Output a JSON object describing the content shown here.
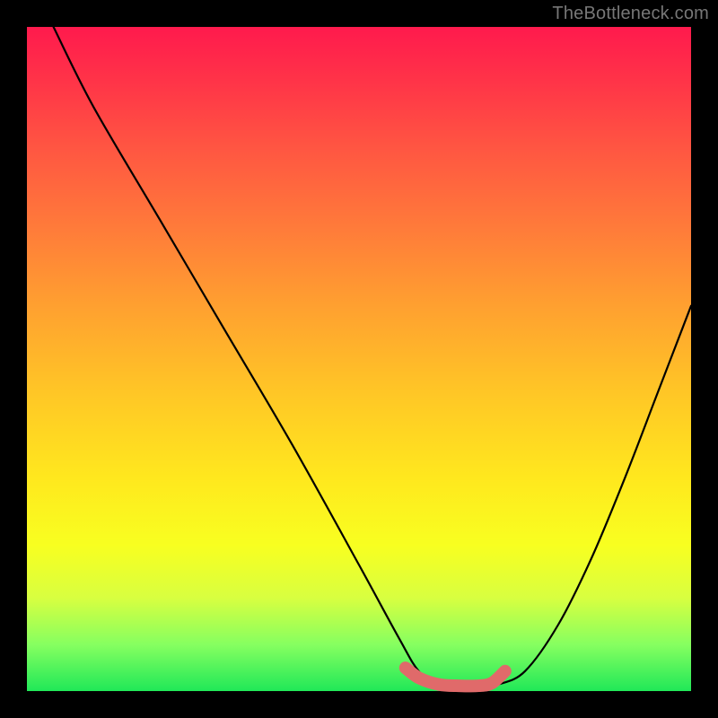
{
  "watermark": "TheBottleneck.com",
  "chart_data": {
    "type": "line",
    "title": "",
    "xlabel": "",
    "ylabel": "",
    "xlim": [
      0,
      100
    ],
    "ylim": [
      0,
      100
    ],
    "series": [
      {
        "name": "curve",
        "x": [
          4,
          10,
          20,
          30,
          40,
          50,
          56,
          59,
          62,
          65,
          68,
          71,
          75,
          80,
          85,
          90,
          95,
          100
        ],
        "y": [
          100,
          88,
          71,
          54,
          37,
          19,
          8,
          3,
          1,
          0.5,
          0.5,
          1,
          3,
          10,
          20,
          32,
          45,
          58
        ]
      },
      {
        "name": "highlight",
        "x": [
          57,
          59,
          62,
          65,
          68,
          70,
          72
        ],
        "y": [
          3.5,
          2,
          1,
          0.8,
          0.8,
          1.2,
          3
        ]
      }
    ]
  },
  "colors": {
    "curve": "#000000",
    "highlight": "#e06a6a",
    "background_top": "#ff1a4d",
    "background_bottom": "#20e858",
    "frame": "#000000"
  }
}
